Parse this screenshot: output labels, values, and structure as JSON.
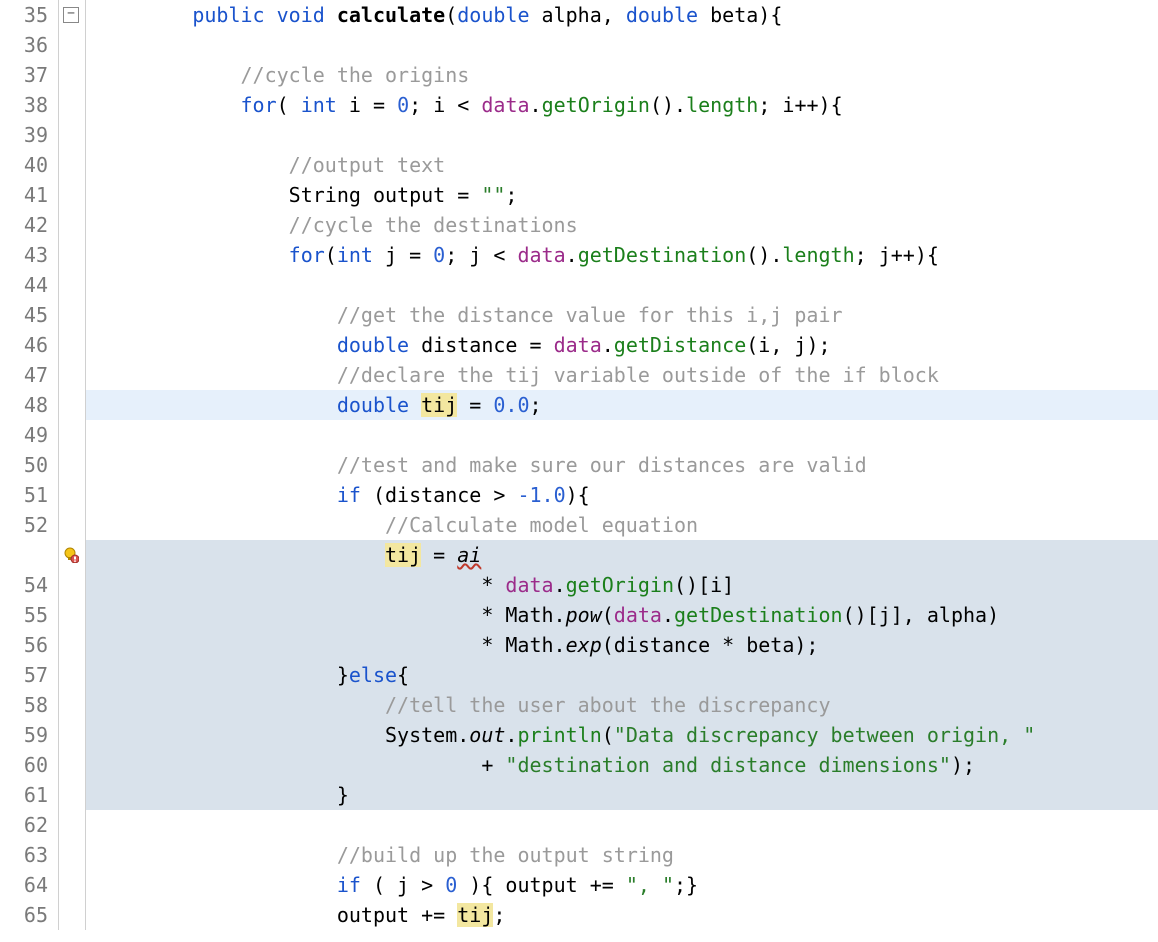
{
  "gutter": {
    "start": 35,
    "end": 65,
    "error_line": 53,
    "fold_line": 35
  },
  "highlight": {
    "line": 48,
    "block_start": 53,
    "block_end": 61
  },
  "code": {
    "l35": {
      "indent": "        ",
      "kw1": "public",
      "sp1": " ",
      "kw2": "void",
      "sp2": " ",
      "name": "calculate",
      "sig1": "(",
      "kw3": "double",
      "sp3": " alpha, ",
      "kw4": "double",
      "sp4": " beta){"
    },
    "l36": "",
    "l37": {
      "indent": "            ",
      "text": "//cycle the origins"
    },
    "l38": {
      "indent": "            ",
      "kw1": "for",
      "t1": "( ",
      "kw2": "int",
      "t2": " i = ",
      "num": "0",
      "t3": "; i < ",
      "fld": "data",
      "t4": ".",
      "call1": "getOrigin",
      "t5": "().",
      "call2": "length",
      "t6": "; i++){"
    },
    "l39": "",
    "l40": {
      "indent": "                ",
      "text": "//output text"
    },
    "l41": {
      "indent": "                ",
      "t1": "String output = ",
      "str": "\"\"",
      "t2": ";"
    },
    "l42": {
      "indent": "                ",
      "text": "//cycle the destinations"
    },
    "l43": {
      "indent": "                ",
      "kw1": "for",
      "t1": "(",
      "kw2": "int",
      "t2": " j = ",
      "num": "0",
      "t3": "; j < ",
      "fld": "data",
      "t4": ".",
      "call1": "getDestination",
      "t5": "().",
      "call2": "length",
      "t6": "; j++){"
    },
    "l44": "",
    "l45": {
      "indent": "                    ",
      "text": "//get the distance value for this i,j pair"
    },
    "l46": {
      "indent": "                    ",
      "kw": "double",
      "t1": " distance = ",
      "fld": "data",
      "t2": ".",
      "call": "getDistance",
      "t3": "(i, j);"
    },
    "l47": {
      "indent": "                    ",
      "text": "//declare the tij variable outside of the if block"
    },
    "l48": {
      "indent": "                    ",
      "kw": "double",
      "sp": " ",
      "mark": "tij",
      "t1": " = ",
      "num": "0.0",
      "t2": ";"
    },
    "l49": "",
    "l50": {
      "indent": "                    ",
      "text": "//test and make sure our distances are valid"
    },
    "l51": {
      "indent": "                    ",
      "kw": "if",
      "t1": " (distance > ",
      "num": "-1.0",
      "t2": "){"
    },
    "l52": {
      "indent": "                        ",
      "text": "//Calculate model equation"
    },
    "l53": {
      "indent": "                        ",
      "mark": "tij",
      "t1": " = ",
      "err": "ai"
    },
    "l54": {
      "indent": "                                ",
      "t1": "* ",
      "fld": "data",
      "t2": ".",
      "call": "getOrigin",
      "t3": "()[i]"
    },
    "l55": {
      "indent": "                                ",
      "t1": "* Math.",
      "it": "pow",
      "t2": "(",
      "fld": "data",
      "t3": ".",
      "call": "getDestination",
      "t4": "()[j], alpha)"
    },
    "l56": {
      "indent": "                                ",
      "t1": "* Math.",
      "it": "exp",
      "t2": "(distance * beta);"
    },
    "l57": {
      "indent": "                    ",
      "t1": "}",
      "kw": "else",
      "t2": "{"
    },
    "l58": {
      "indent": "                        ",
      "text": "//tell the user about the discrepancy"
    },
    "l59": {
      "indent": "                        ",
      "t1": "System.",
      "it": "out",
      "t2": ".",
      "call": "println",
      "t3": "(",
      "str": "\"Data discrepancy between origin, \""
    },
    "l60": {
      "indent": "                                ",
      "t1": "+ ",
      "str": "\"destination and distance dimensions\"",
      "t2": ");"
    },
    "l61": {
      "indent": "                    ",
      "t": "}"
    },
    "l62": "",
    "l63": {
      "indent": "                    ",
      "text": "//build up the output string"
    },
    "l64": {
      "indent": "                    ",
      "kw": "if",
      "t1": " ( j > ",
      "num": "0",
      "t2": " ){ output += ",
      "str": "\", \"",
      "t3": ";}"
    },
    "l65": {
      "indent": "                    ",
      "t1": "output += ",
      "mark": "tij",
      "t2": ";"
    }
  }
}
